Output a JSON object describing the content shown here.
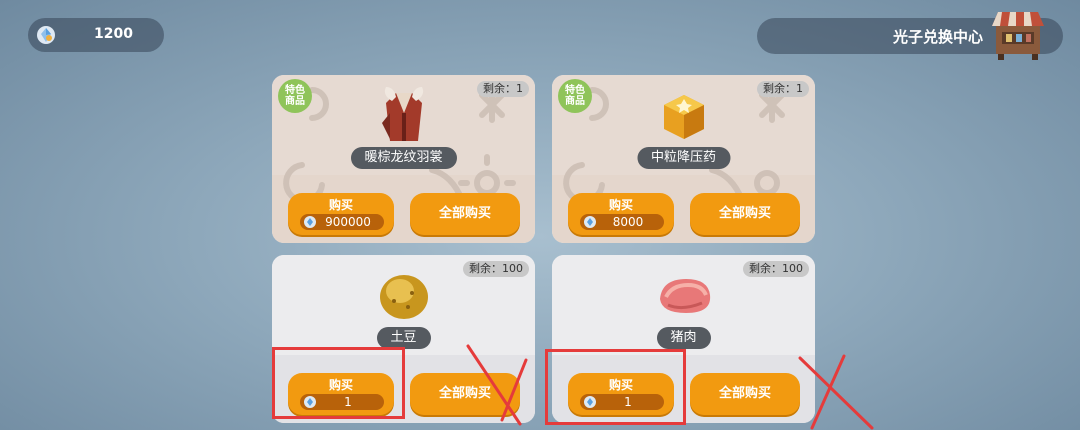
{
  "currency": {
    "amount": "1200",
    "icon": "crystal-icon"
  },
  "header": {
    "title": "光子兑换中心",
    "icon": "shop-stall-icon"
  },
  "cards": [
    {
      "badge": [
        "特色",
        "商品"
      ],
      "stock": "剩余：1",
      "name": "暖棕龙纹羽裳",
      "item_icon": "outfit-icon",
      "buy_label": "购买",
      "price": "900000",
      "buy_all_label": "全部购买"
    },
    {
      "badge": [
        "特色",
        "商品"
      ],
      "stock": "剩余：1",
      "name": "中粒降压药",
      "item_icon": "medicine-cube-icon",
      "buy_label": "购买",
      "price": "8000",
      "buy_all_label": "全部购买"
    },
    {
      "stock": "剩余：100",
      "name": "土豆",
      "item_icon": "potato-icon",
      "buy_label": "购买",
      "price": "1",
      "buy_all_label": "全部购买"
    },
    {
      "stock": "剩余：100",
      "name": "猪肉",
      "item_icon": "pork-icon",
      "buy_label": "购买",
      "price": "1",
      "buy_all_label": "全部购买"
    }
  ],
  "colors": {
    "accent": "#f29a10",
    "annotation": "#e53b3b",
    "badge": "#8fc45a"
  }
}
